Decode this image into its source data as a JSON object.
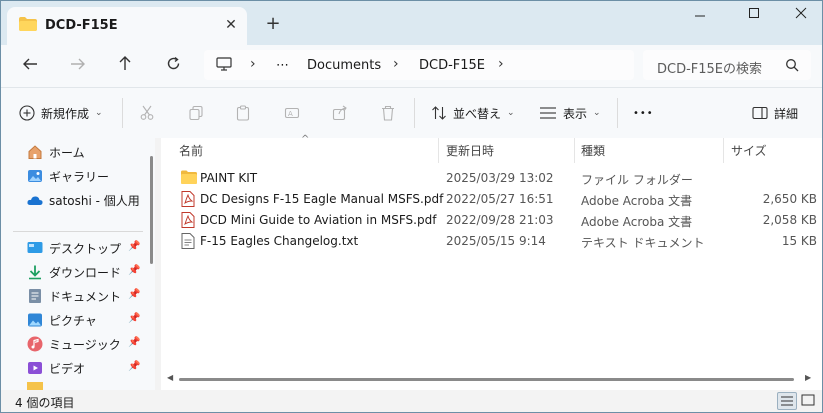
{
  "tab": {
    "title": "DCD-F15E",
    "close_icon": "close-icon",
    "new_tab_icon": "plus-icon"
  },
  "window_controls": {
    "minimize": "minimize-icon",
    "maximize": "maximize-icon",
    "close": "close-icon"
  },
  "nav": {
    "back": "back-arrow-icon",
    "forward": "forward-arrow-icon",
    "up": "up-arrow-icon",
    "refresh": "refresh-icon"
  },
  "address": {
    "ellipsis": "⋯",
    "crumbs": [
      "Documents",
      "DCD-F15E"
    ]
  },
  "search": {
    "placeholder": "DCD-F15Eの検索"
  },
  "commands": {
    "new_label": "新規作成",
    "sort_label": "並べ替え",
    "view_label": "表示",
    "more": "•••",
    "details_label": "詳細"
  },
  "sidebar": {
    "items": [
      {
        "label": "ホーム",
        "icon": "home-icon"
      },
      {
        "label": "ギャラリー",
        "icon": "gallery-icon"
      },
      {
        "label": "satoshi - 個人用",
        "icon": "onedrive-cloud-icon"
      },
      {
        "label": "デスクトップ",
        "icon": "desktop-icon"
      },
      {
        "label": "ダウンロード",
        "icon": "download-icon"
      },
      {
        "label": "ドキュメント",
        "icon": "documents-icon"
      },
      {
        "label": "ピクチャ",
        "icon": "pictures-icon"
      },
      {
        "label": "ミュージック",
        "icon": "music-icon"
      },
      {
        "label": "ビデオ",
        "icon": "video-icon"
      }
    ]
  },
  "columns": {
    "name": "名前",
    "date": "更新日時",
    "type": "種類",
    "size": "サイズ"
  },
  "files": [
    {
      "name": "PAINT KIT",
      "date": "2025/03/29 13:02",
      "type": "ファイル フォルダー",
      "size": "",
      "icon": "folder-icon"
    },
    {
      "name": "DC Designs F-15 Eagle Manual MSFS.pdf",
      "date": "2022/05/27 16:51",
      "type": "Adobe Acroba 文書",
      "size": "2,650 KB",
      "icon": "pdf-icon"
    },
    {
      "name": "DCD Mini Guide to Aviation in MSFS.pdf",
      "date": "2022/09/28 21:03",
      "type": "Adobe Acroba 文書",
      "size": "2,058 KB",
      "icon": "pdf-icon"
    },
    {
      "name": "F-15 Eagles Changelog.txt",
      "date": "2025/05/15 9:14",
      "type": "テキスト ドキュメント",
      "size": "15 KB",
      "icon": "text-file-icon"
    }
  ],
  "status": {
    "count_text": "4 個の項目"
  }
}
